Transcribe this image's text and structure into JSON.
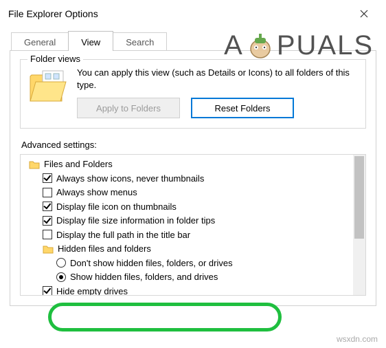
{
  "window": {
    "title": "File Explorer Options"
  },
  "tabs": {
    "general": "General",
    "view": "View",
    "search": "Search"
  },
  "folder_views": {
    "group_title": "Folder views",
    "text": "You can apply this view (such as Details or Icons) to all folders of this type.",
    "apply_btn": "Apply to Folders",
    "reset_btn": "Reset Folders"
  },
  "advanced": {
    "label": "Advanced settings:",
    "root": "Files and Folders",
    "items": {
      "always_icons": "Always show icons, never thumbnails",
      "always_menus": "Always show menus",
      "file_icon_thumb": "Display file icon on thumbnails",
      "file_size_tips": "Display file size information in folder tips",
      "full_path_title": "Display the full path in the title bar",
      "hidden_group": "Hidden files and folders",
      "dont_show_hidden": "Don't show hidden files, folders, or drives",
      "show_hidden": "Show hidden files, folders, and drives",
      "hide_empty": "Hide empty drives"
    }
  },
  "watermark": {
    "brand_a": "A",
    "brand_rest": "PUALS",
    "site": "wsxdn.com"
  }
}
